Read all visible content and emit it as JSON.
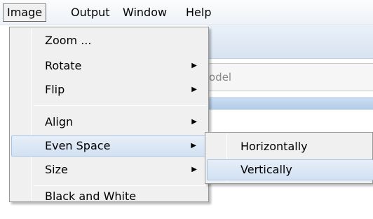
{
  "menubar": {
    "items": [
      "Image",
      "Output",
      "Window",
      "Help"
    ]
  },
  "background": {
    "field_text": "odel"
  },
  "image_menu": {
    "items": [
      {
        "label": "Zoom ...",
        "submenu": false
      },
      {
        "label": "Rotate",
        "submenu": true
      },
      {
        "label": "Flip",
        "submenu": true
      },
      {
        "label": "Align",
        "submenu": true
      },
      {
        "label": "Even Space",
        "submenu": true,
        "highlighted": true
      },
      {
        "label": "Size",
        "submenu": true
      },
      {
        "label": "Black and White",
        "submenu": false
      }
    ],
    "arrow_glyph": "▶"
  },
  "even_space_submenu": {
    "items": [
      {
        "label": "Horizontally"
      },
      {
        "label": "Vertically",
        "highlighted": true
      }
    ]
  },
  "colors": {
    "highlight": "#d2e1f3",
    "menu_bg": "#f0f0f0"
  }
}
